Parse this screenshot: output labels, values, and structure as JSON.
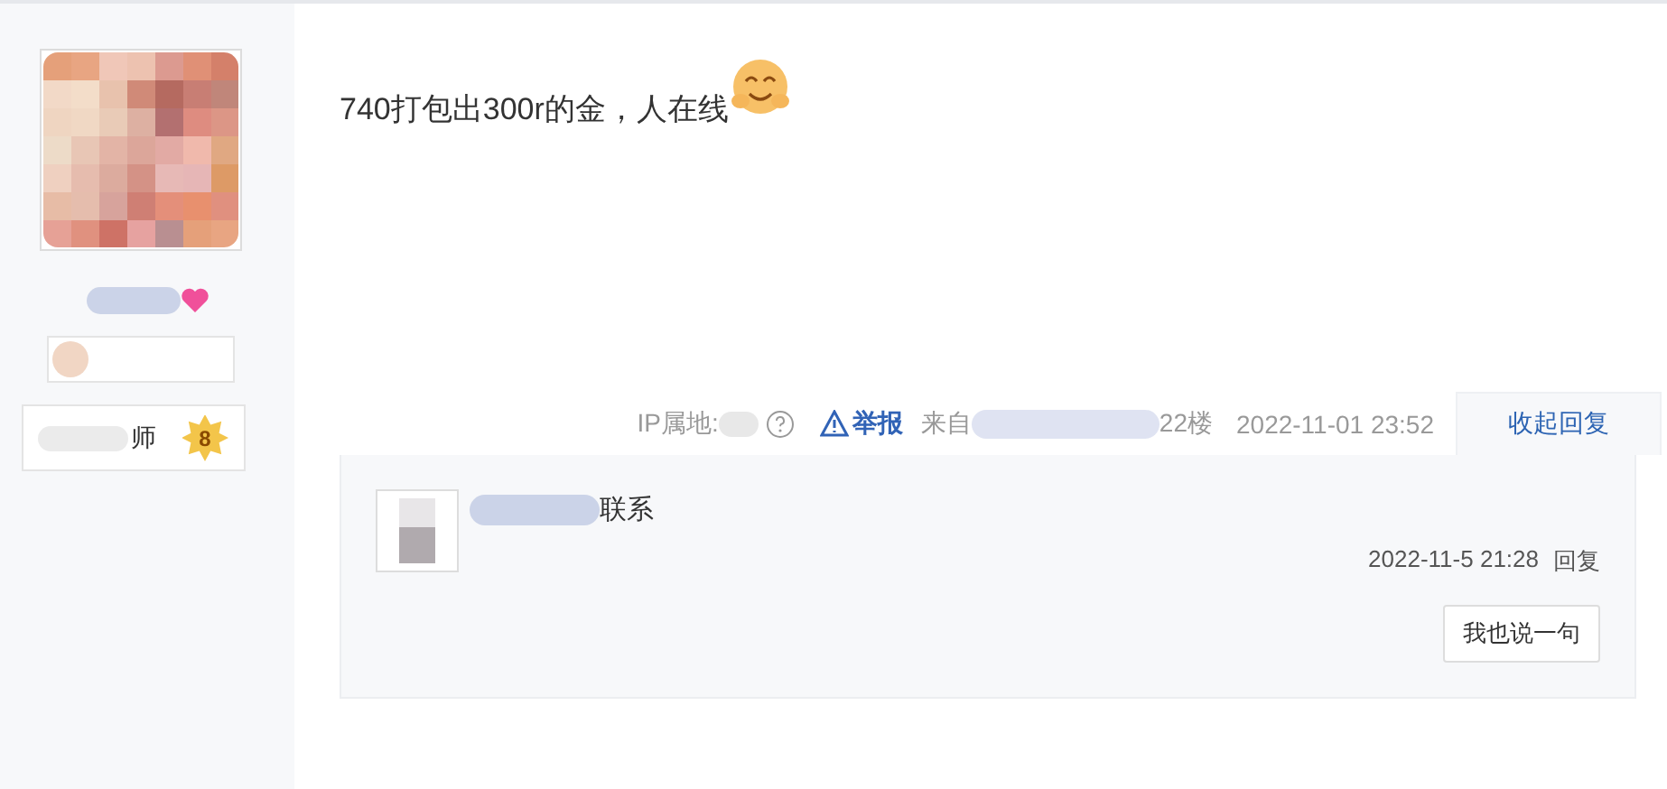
{
  "author": {
    "badge": {
      "title": "师",
      "level": "8"
    }
  },
  "post": {
    "text": "740打包出300r的金，人在线"
  },
  "meta": {
    "ip_label": "IP属地:",
    "report": "举报",
    "source_label": "来自",
    "floor": "22楼",
    "time": "2022-11-01 23:52",
    "toggle_replies": "收起回复"
  },
  "replies": [
    {
      "text": "联系",
      "time": "2022-11-5 21:28",
      "reply": "回复"
    }
  ],
  "reply_button": "我也说一句"
}
